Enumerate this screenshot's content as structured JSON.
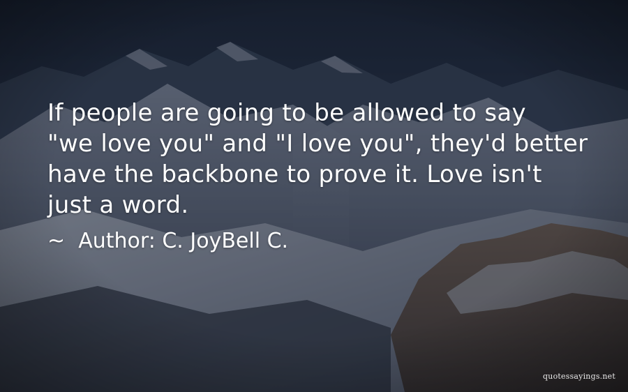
{
  "quote": {
    "lines": [
      "If people are going to be allowed to say",
      "\"we love you\" and \"I love you\", they'd better",
      "have the backbone to prove it. Love isn't",
      "just a word."
    ],
    "author_prefix": "~",
    "author_label": "Author:",
    "author_name": "C. JoyBell C."
  },
  "watermark": "quotessayings.net",
  "colors": {
    "sky_top": "#1c2536",
    "sky_mid": "#2c3a52",
    "snow": "#8e96a8",
    "text": "#ffffff"
  }
}
